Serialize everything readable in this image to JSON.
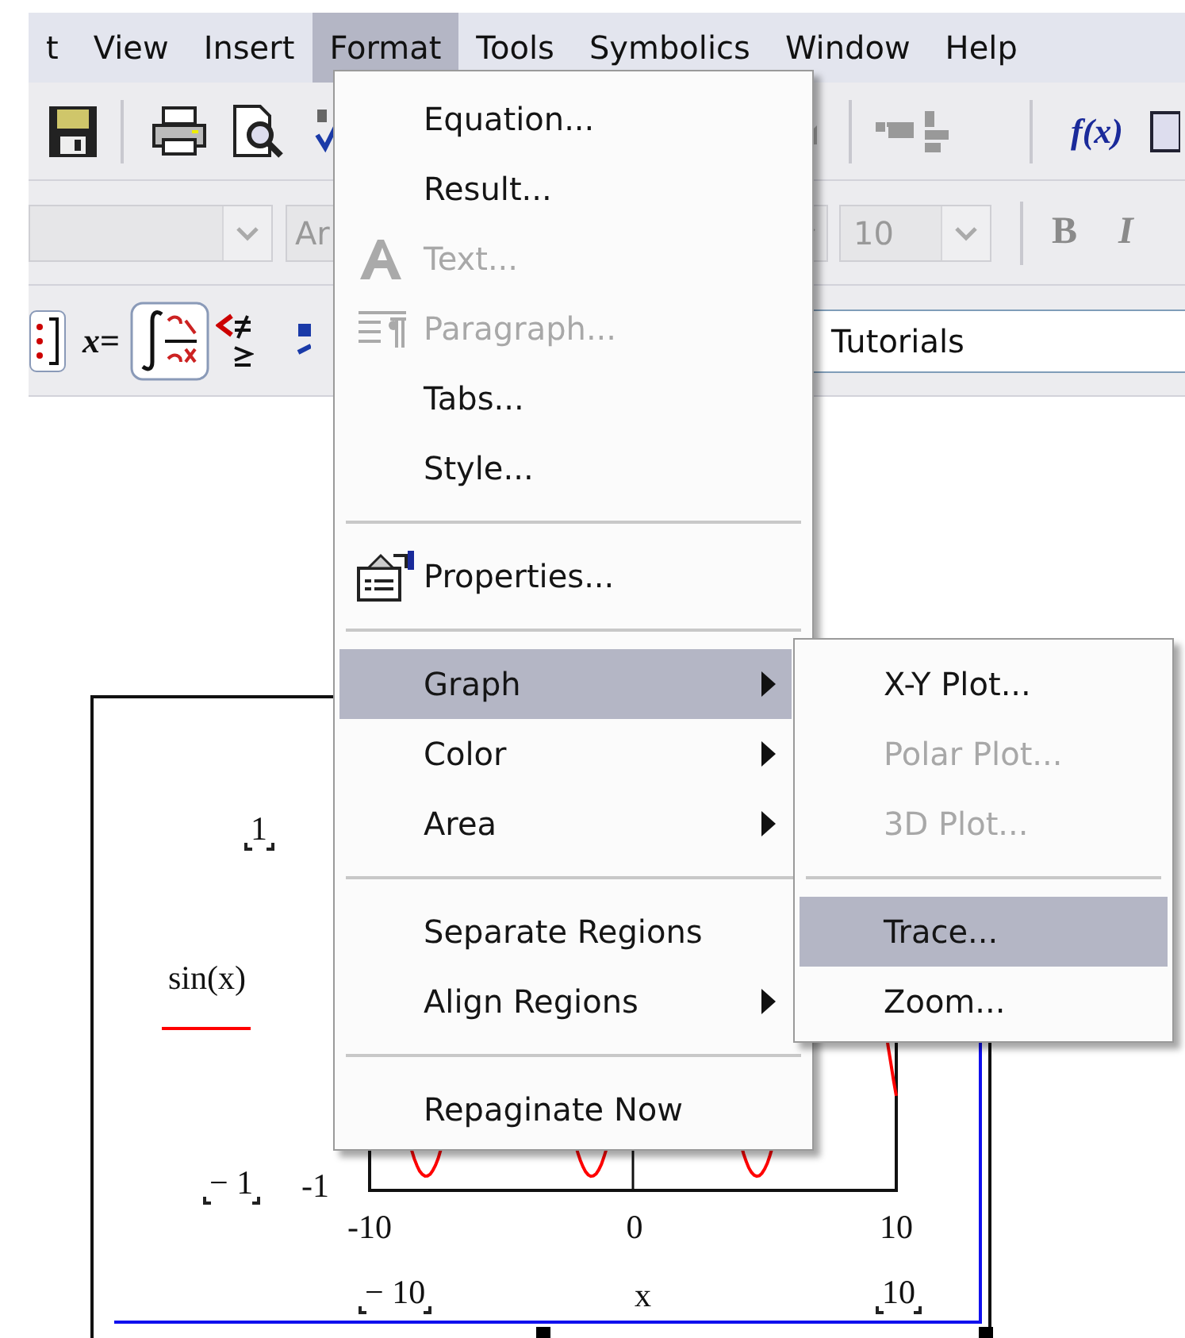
{
  "menu_bar": {
    "items": [
      {
        "label": "t",
        "selected": false
      },
      {
        "label": "View",
        "selected": false
      },
      {
        "label": "Insert",
        "selected": false
      },
      {
        "label": "Format",
        "selected": true
      },
      {
        "label": "Tools",
        "selected": false
      },
      {
        "label": "Symbolics",
        "selected": false
      },
      {
        "label": "Window",
        "selected": false
      },
      {
        "label": "Help",
        "selected": false
      }
    ]
  },
  "standard_toolbar": {
    "function_button": "f(x)"
  },
  "formatting_toolbar": {
    "font_field": "Ar",
    "size_field": "10",
    "bold_button": "B",
    "italic_button": "I"
  },
  "math_toolbar": {
    "evaluate_button": "*x*=",
    "resources_field": "Tutorials"
  },
  "format_menu": {
    "items": [
      {
        "kind": "item",
        "label": "Equation...",
        "disabled": false,
        "selected": false,
        "submenu": false
      },
      {
        "kind": "item",
        "label": "Result...",
        "disabled": false,
        "selected": false,
        "submenu": false
      },
      {
        "kind": "item",
        "label": "Text...",
        "disabled": true,
        "selected": false,
        "submenu": false
      },
      {
        "kind": "item",
        "label": "Paragraph...",
        "disabled": true,
        "selected": false,
        "submenu": false
      },
      {
        "kind": "item",
        "label": "Tabs...",
        "disabled": false,
        "selected": false,
        "submenu": false
      },
      {
        "kind": "item",
        "label": "Style...",
        "disabled": false,
        "selected": false,
        "submenu": false
      },
      {
        "kind": "separator"
      },
      {
        "kind": "item",
        "label": "Properties...",
        "disabled": false,
        "selected": false,
        "submenu": false
      },
      {
        "kind": "separator"
      },
      {
        "kind": "item",
        "label": "Graph",
        "disabled": false,
        "selected": true,
        "submenu": true
      },
      {
        "kind": "item",
        "label": "Color",
        "disabled": false,
        "selected": false,
        "submenu": true
      },
      {
        "kind": "item",
        "label": "Area",
        "disabled": false,
        "selected": false,
        "submenu": true
      },
      {
        "kind": "separator"
      },
      {
        "kind": "item",
        "label": "Separate Regions",
        "disabled": false,
        "selected": false,
        "submenu": false
      },
      {
        "kind": "item",
        "label": "Align Regions",
        "disabled": false,
        "selected": false,
        "submenu": true
      },
      {
        "kind": "separator"
      },
      {
        "kind": "item",
        "label": "Repaginate Now",
        "disabled": false,
        "selected": false,
        "submenu": false
      }
    ]
  },
  "graph_submenu": {
    "items": [
      {
        "kind": "item",
        "label": "X-Y Plot...",
        "disabled": false,
        "selected": false,
        "submenu": false
      },
      {
        "kind": "item",
        "label": "Polar Plot...",
        "disabled": true,
        "selected": false,
        "submenu": false
      },
      {
        "kind": "item",
        "label": "3D Plot...",
        "disabled": true,
        "selected": false,
        "submenu": false
      },
      {
        "kind": "separator"
      },
      {
        "kind": "item",
        "label": "Trace...",
        "disabled": false,
        "selected": true,
        "submenu": false
      },
      {
        "kind": "item",
        "label": "Zoom...",
        "disabled": false,
        "selected": false,
        "submenu": false
      }
    ]
  },
  "plot": {
    "upper_limit": "1",
    "trace": "sin(x)",
    "lower_limit": "− 1",
    "y_tick": "-1",
    "x_ticks": [
      "-10",
      "0",
      "10"
    ],
    "x_min": "− 10",
    "x_label": "x",
    "x_max": "10"
  }
}
